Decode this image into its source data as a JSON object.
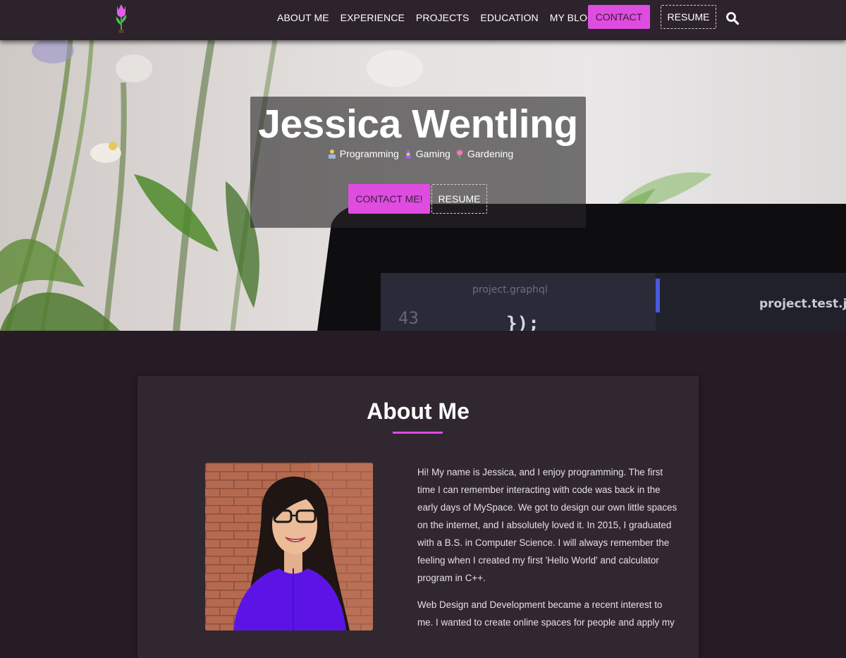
{
  "nav": {
    "links": [
      "ABOUT ME",
      "EXPERIENCE",
      "PROJECTS",
      "EDUCATION",
      "MY BLOG"
    ],
    "contact_label": "CONTACT",
    "resume_label": "RESUME",
    "logo_icon": "tulip-icon",
    "search_icon": "search-icon"
  },
  "hero": {
    "name": "Jessica Wentling",
    "interests": [
      {
        "icon": "technologist-emoji",
        "label": "Programming"
      },
      {
        "icon": "mage-emoji",
        "label": "Gaming"
      },
      {
        "icon": "tulip-emoji",
        "label": "Gardening"
      }
    ],
    "contact_label": "CONTACT ME!",
    "resume_label": "RESUME",
    "screen_text": {
      "tab_left": "project.graphql",
      "tab_right": "project.test.js",
      "line_number": "43",
      "code": "});"
    }
  },
  "about": {
    "title": "About Me",
    "paragraphs": [
      "Hi! My name is Jessica, and I enjoy programming. The first time I can remember interacting with code was back in the early days of MySpace. We got to design our own little spaces on the internet, and I absolutely loved it. In 2015, I graduated with a B.S. in Computer Science. I will always remember the feeling when I created my first 'Hello World' and calculator program in C++.",
      "Web Design and Development became a recent interest to me. I wanted to create online spaces for people and apply my"
    ]
  },
  "colors": {
    "accent": "#de4de0",
    "nav_bg": "#2d232d",
    "page_bg": "#261c26",
    "card_bg": "#302730"
  }
}
